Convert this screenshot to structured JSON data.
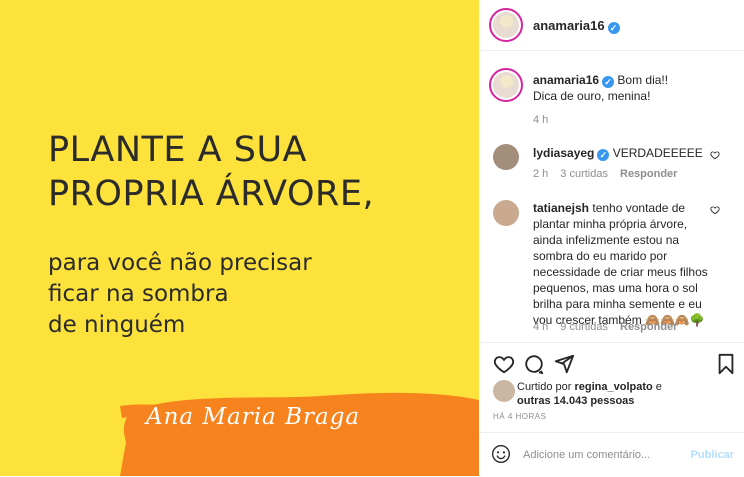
{
  "post": {
    "headline": [
      "PLANTE A SUA",
      "PROPRIA ÁRVORE,"
    ],
    "subline": [
      "para você não precisar",
      "ficar na sombra",
      "de ninguém"
    ],
    "signature": "Ana Maria Braga",
    "bg_color": "#fce23a",
    "brush_color": "#f7831f"
  },
  "header": {
    "username": "anamaria16",
    "more_icon": "more-horizontal-icon"
  },
  "caption": {
    "username": "anamaria16",
    "text_line1": "Bom dia!!",
    "text_line2": "Dica de ouro, menina!",
    "time": "4 h"
  },
  "comments": [
    {
      "username": "lydiasayeg",
      "text": "VERDADEEEEE",
      "time": "2 h",
      "likes": "3 curtidas",
      "reply": "Responder"
    },
    {
      "username": "tatianejsh",
      "text_lines": [
        "tenho vontade de",
        "plantar minha própria árvore,",
        "ainda infelizmente estou na",
        "sombra do eu marido por",
        "necessidade de criar meus filhos",
        "pequenos, mas uma hora o sol",
        "brilha para minha semente e eu",
        "vou crescer também 🙈🙈🙈🌳"
      ],
      "time": "4 h",
      "likes": "9 curtidas",
      "reply": "Responder"
    }
  ],
  "likes": {
    "prefix": "Curtido por",
    "user": "regina_volpato",
    "connector": "e",
    "others": "outras 14.043 pessoas"
  },
  "timestamp": "HÁ 4 HORAS",
  "comment_box": {
    "placeholder": "Adicione um comentário...",
    "publish": "Publicar"
  }
}
